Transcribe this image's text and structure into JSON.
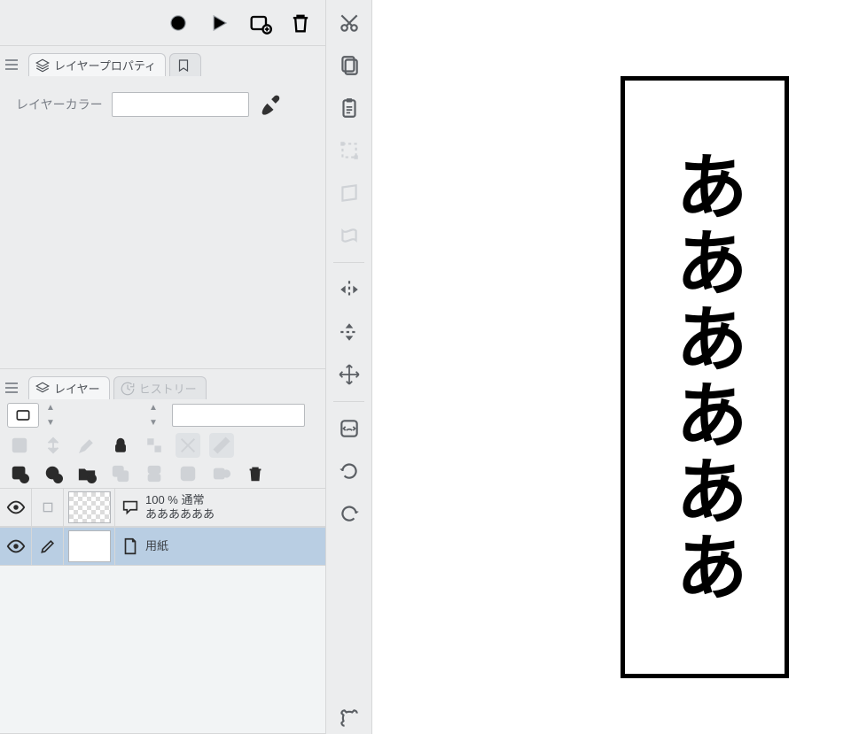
{
  "transport": {
    "record_icon": "record",
    "play_icon": "play",
    "add_clip_icon": "add-clip",
    "trash_icon": "trash"
  },
  "properties_panel": {
    "tab_label": "レイヤープロパティ",
    "layer_color_label": "レイヤーカラー"
  },
  "layer_panel": {
    "tab_layer": "レイヤー",
    "tab_history": "ヒストリー",
    "layers": [
      {
        "opacity_line": "100 % 通常",
        "name": "ああああああ",
        "selected": false,
        "kind": "text"
      },
      {
        "opacity_line": "",
        "name": "用紙",
        "selected": true,
        "kind": "paper"
      }
    ]
  },
  "canvas": {
    "speech_text": "ああああああ"
  }
}
